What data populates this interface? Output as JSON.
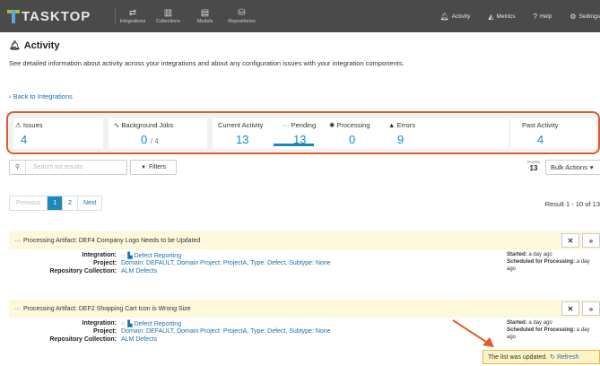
{
  "app": {
    "brand": "TASKTOP"
  },
  "nav": {
    "items": [
      {
        "label": "Integrations",
        "icon": "swap-arrows-icon"
      },
      {
        "label": "Collections",
        "icon": "trash-bin-icon"
      },
      {
        "label": "Models",
        "icon": "document-icon"
      },
      {
        "label": "Repositories",
        "icon": "database-icon"
      }
    ],
    "right": [
      {
        "label": "Activity",
        "icon": "bell-icon"
      },
      {
        "label": "Metrics",
        "icon": "chart-icon"
      },
      {
        "label": "Help",
        "icon": "question-icon"
      },
      {
        "label": "Settings",
        "icon": "gear-icon"
      }
    ]
  },
  "header": {
    "title": "Activity",
    "description": "See detailed information about activity across your integrations and about any configuration issues with your integration components.",
    "back_link": "Back to Integrations"
  },
  "stats": {
    "issues": {
      "label": "Issues",
      "value": "4"
    },
    "background_jobs": {
      "label": "Background Jobs",
      "value": "0",
      "total": "/ 4"
    },
    "current_activity": {
      "label": "Current Activity",
      "value": "13"
    },
    "pending": {
      "label": "Pending",
      "value": "13"
    },
    "processing": {
      "label": "Processing",
      "value": "0"
    },
    "errors": {
      "label": "Errors",
      "value": "9"
    },
    "past_activity": {
      "label": "Past Activity",
      "value": "4"
    }
  },
  "toolbar": {
    "search_placeholder": "Search list results",
    "filters_label": "Filters",
    "events_label": "Events",
    "events_count": "13",
    "bulk_actions_label": "Bulk Actions"
  },
  "pagination": {
    "previous": "Previous",
    "pages": [
      "1",
      "2"
    ],
    "next": "Next",
    "result_text": "Result 1 - 10 of 13"
  },
  "artifacts": [
    {
      "title": "Processing Artifact: DEF4 Company Logo Needs to be Updated",
      "integration_label": "Integration:",
      "integration": "Defect Reporting",
      "project_label": "Project:",
      "project": "Domain: DEFAULT, Domain Project: ProjectA, Type: Defect, Subtype: None",
      "collection_label": "Repository Collection:",
      "collection": "ALM Defects",
      "started_label": "Started:",
      "started": "a day ago",
      "scheduled_label": "Scheduled for Processing:",
      "scheduled": "a day ago"
    },
    {
      "title": "Processing Artifact: DEF2 Shopping Cart Icon is Wrong Size",
      "integration_label": "Integration:",
      "integration": "Defect Reporting",
      "project_label": "Project:",
      "project": "Domain: DEFAULT, Domain Project: ProjectA, Type: Defect, Subtype: None",
      "collection_label": "Repository Collection:",
      "collection": "ALM Defects",
      "started_label": "Started:",
      "started": "a day ago",
      "scheduled_label": "Scheduled for Processing:",
      "scheduled": "a day ago"
    }
  ],
  "toast": {
    "message": "The list was updated.",
    "refresh_label": "Refresh"
  },
  "colors": {
    "accent": "#1b8ab8",
    "highlight_border": "#e05a2b",
    "topbar": "#4a4a4a",
    "card_header": "#fdf7dc"
  }
}
